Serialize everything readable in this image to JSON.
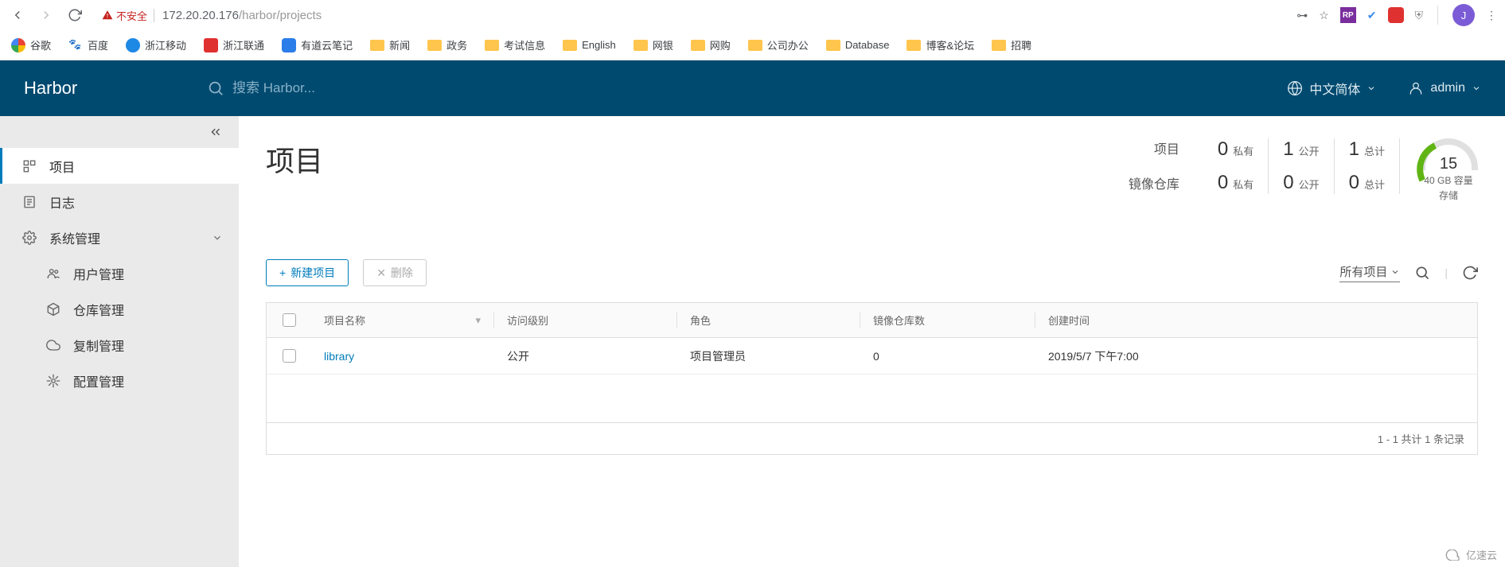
{
  "browser": {
    "insecure_label": "不安全",
    "address_host": "172.20.20.176",
    "address_path": "/harbor/projects",
    "avatar_letter": "J"
  },
  "bookmarks": [
    {
      "label": "谷歌"
    },
    {
      "label": "百度"
    },
    {
      "label": "浙江移动"
    },
    {
      "label": "浙江联通"
    },
    {
      "label": "有道云笔记"
    },
    {
      "label": "新闻"
    },
    {
      "label": "政务"
    },
    {
      "label": "考试信息"
    },
    {
      "label": "English"
    },
    {
      "label": "网银"
    },
    {
      "label": "网购"
    },
    {
      "label": "公司办公"
    },
    {
      "label": "Database"
    },
    {
      "label": "博客&论坛"
    },
    {
      "label": "招聘"
    }
  ],
  "header": {
    "logo": "Harbor",
    "search_placeholder": "搜索 Harbor...",
    "language": "中文简体",
    "user": "admin"
  },
  "sidebar": {
    "items": {
      "projects": "项目",
      "logs": "日志",
      "admin": "系统管理",
      "users": "用户管理",
      "repos": "仓库管理",
      "replication": "复制管理",
      "config": "配置管理"
    }
  },
  "page": {
    "title": "项目",
    "stats": {
      "labels": {
        "projects": "项目",
        "repos": "镜像仓库"
      },
      "projects": {
        "private_n": "0",
        "private_l": "私有",
        "public_n": "1",
        "public_l": "公开",
        "total_n": "1",
        "total_l": "总计"
      },
      "repos": {
        "private_n": "0",
        "private_l": "私有",
        "public_n": "0",
        "public_l": "公开",
        "total_n": "0",
        "total_l": "总计"
      },
      "storage": {
        "value": "15",
        "unit": "40 GB 容量",
        "label": "存储"
      }
    },
    "toolbar": {
      "new_project": "新建项目",
      "delete": "删除",
      "filter": "所有项目"
    },
    "table": {
      "headers": {
        "name": "项目名称",
        "access": "访问级别",
        "role": "角色",
        "repo_count": "镜像仓库数",
        "created": "创建时间"
      },
      "rows": [
        {
          "name": "library",
          "access": "公开",
          "role": "项目管理员",
          "repo_count": "0",
          "created": "2019/5/7 下午7:00"
        }
      ],
      "footer": "1 - 1 共计 1 条记录"
    }
  },
  "watermark": "亿速云"
}
